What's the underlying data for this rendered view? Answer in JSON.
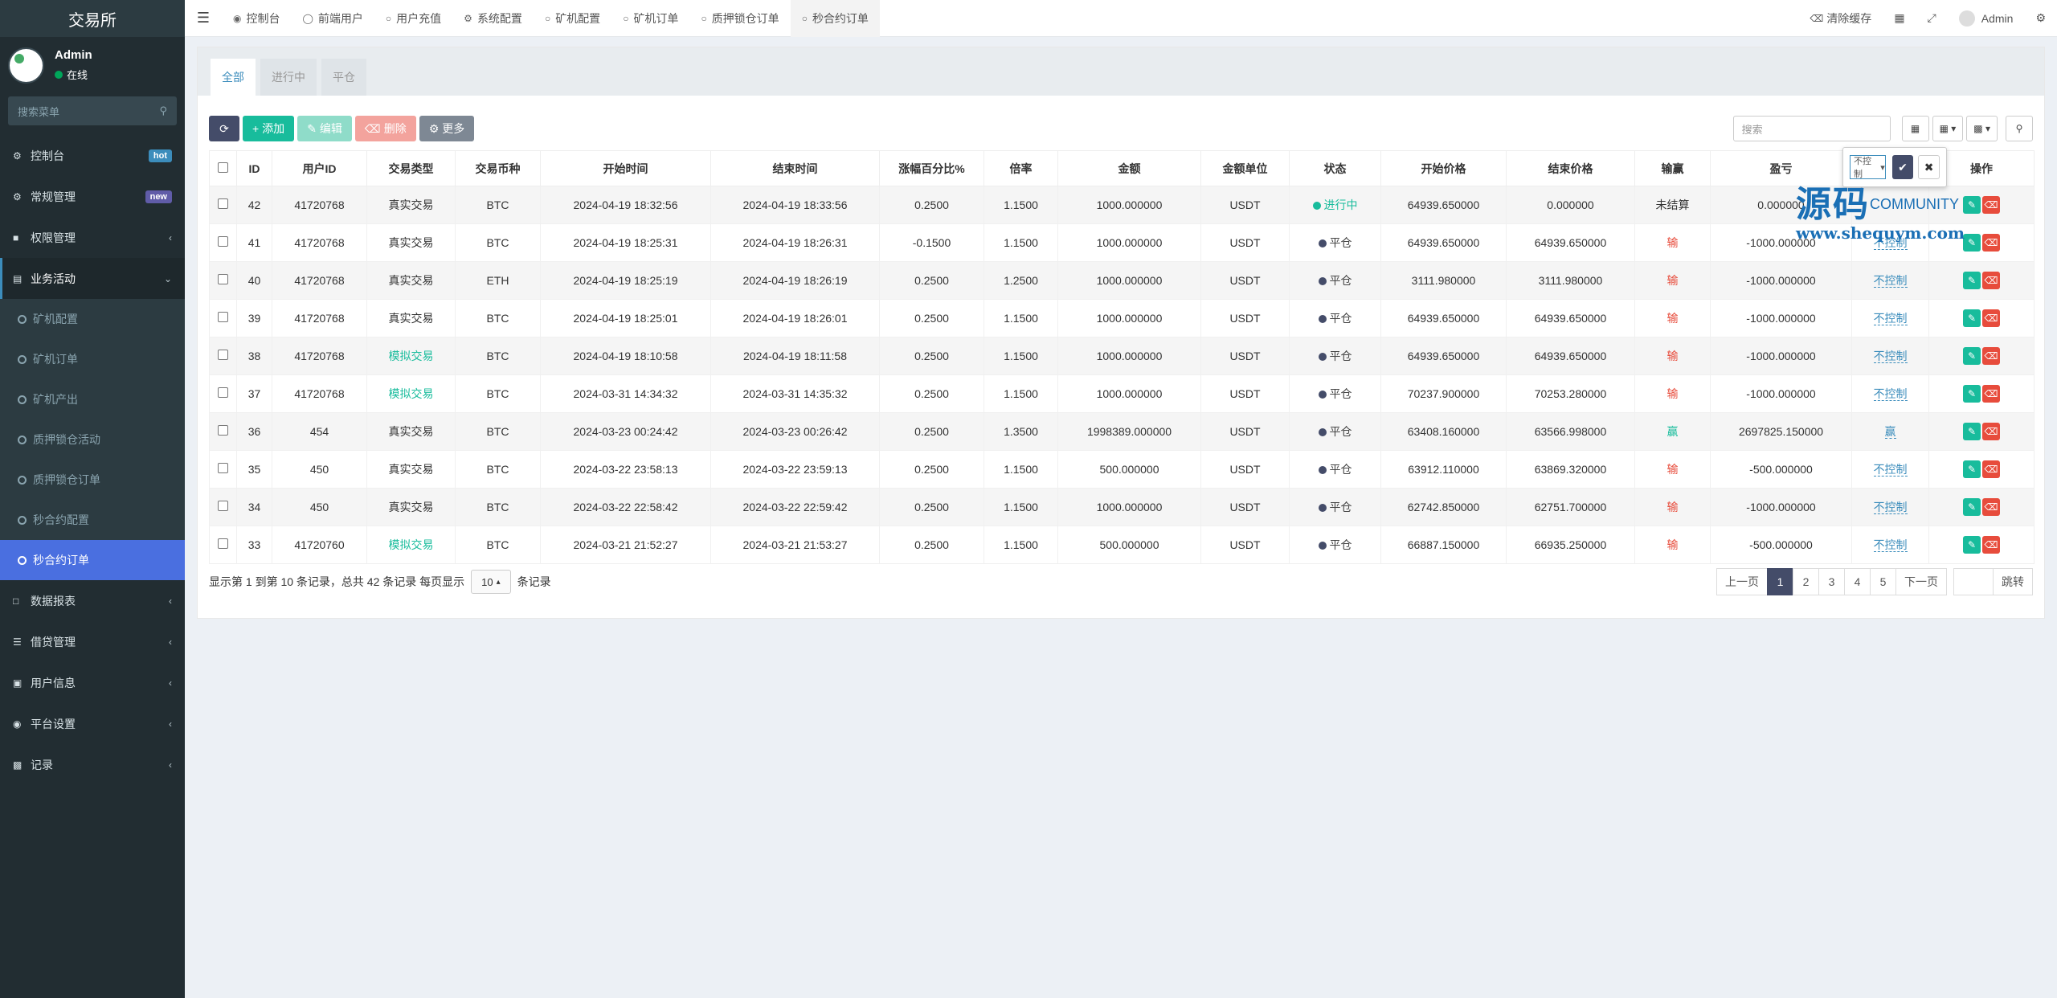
{
  "brand": "交易所",
  "user": {
    "name": "Admin",
    "status": "在线"
  },
  "sidebar": {
    "search_placeholder": "搜索菜单",
    "items": [
      {
        "label": "控制台",
        "icon": "dashboard-icon",
        "badge": "hot"
      },
      {
        "label": "常规管理",
        "icon": "cogs-icon",
        "badge": "new"
      },
      {
        "label": "权限管理",
        "icon": "group-icon"
      },
      {
        "label": "业务活动",
        "icon": "list-icon",
        "open": true
      }
    ],
    "sub_items": [
      "矿机配置",
      "矿机订单",
      "矿机产出",
      "质押锁仓活动",
      "质押锁仓订单",
      "秒合约配置",
      "秒合约订单"
    ],
    "items_after": [
      {
        "label": "数据报表",
        "icon": "file-icon"
      },
      {
        "label": "借贷管理",
        "icon": "list-icon"
      },
      {
        "label": "用户信息",
        "icon": "user-icon"
      },
      {
        "label": "平台设置",
        "icon": "settings-icon"
      },
      {
        "label": "记录",
        "icon": "chart-icon"
      }
    ]
  },
  "header": {
    "tabs": [
      "控制台",
      "前端用户",
      "用户充值",
      "系统配置",
      "矿机配置",
      "矿机订单",
      "质押锁仓订单",
      "秒合约订单"
    ],
    "clear_cache": "清除缓存",
    "admin": "Admin"
  },
  "content": {
    "tabs": [
      "全部",
      "进行中",
      "平仓"
    ],
    "toolbar": {
      "add": "添加",
      "edit": "编辑",
      "delete": "删除",
      "more": "更多",
      "search_placeholder": "搜索"
    },
    "columns": [
      "ID",
      "用户ID",
      "交易类型",
      "交易币种",
      "开始时间",
      "结束时间",
      "涨幅百分比%",
      "倍率",
      "金额",
      "金额单位",
      "状态",
      "开始价格",
      "结束价格",
      "输赢",
      "盈亏",
      "",
      "操作"
    ],
    "rows": [
      {
        "id": "42",
        "uid": "41720768",
        "type": "真实交易",
        "coin": "BTC",
        "start": "2024-04-19 18:32:56",
        "end": "2024-04-19 18:33:56",
        "pct": "0.2500",
        "rate": "1.1500",
        "amount": "1000.000000",
        "unit": "USDT",
        "status": "进行中",
        "sp": "64939.650000",
        "ep": "0.000000",
        "result": "未结算",
        "pnl": "0.000000",
        "ctl": ""
      },
      {
        "id": "41",
        "uid": "41720768",
        "type": "真实交易",
        "coin": "BTC",
        "start": "2024-04-19 18:25:31",
        "end": "2024-04-19 18:26:31",
        "pct": "-0.1500",
        "rate": "1.1500",
        "amount": "1000.000000",
        "unit": "USDT",
        "status": "平仓",
        "sp": "64939.650000",
        "ep": "64939.650000",
        "result": "输",
        "pnl": "-1000.000000",
        "ctl": "不控制"
      },
      {
        "id": "40",
        "uid": "41720768",
        "type": "真实交易",
        "coin": "ETH",
        "start": "2024-04-19 18:25:19",
        "end": "2024-04-19 18:26:19",
        "pct": "0.2500",
        "rate": "1.2500",
        "amount": "1000.000000",
        "unit": "USDT",
        "status": "平仓",
        "sp": "3111.980000",
        "ep": "3111.980000",
        "result": "输",
        "pnl": "-1000.000000",
        "ctl": "不控制"
      },
      {
        "id": "39",
        "uid": "41720768",
        "type": "真实交易",
        "coin": "BTC",
        "start": "2024-04-19 18:25:01",
        "end": "2024-04-19 18:26:01",
        "pct": "0.2500",
        "rate": "1.1500",
        "amount": "1000.000000",
        "unit": "USDT",
        "status": "平仓",
        "sp": "64939.650000",
        "ep": "64939.650000",
        "result": "输",
        "pnl": "-1000.000000",
        "ctl": "不控制"
      },
      {
        "id": "38",
        "uid": "41720768",
        "type": "模拟交易",
        "coin": "BTC",
        "start": "2024-04-19 18:10:58",
        "end": "2024-04-19 18:11:58",
        "pct": "0.2500",
        "rate": "1.1500",
        "amount": "1000.000000",
        "unit": "USDT",
        "status": "平仓",
        "sp": "64939.650000",
        "ep": "64939.650000",
        "result": "输",
        "pnl": "-1000.000000",
        "ctl": "不控制"
      },
      {
        "id": "37",
        "uid": "41720768",
        "type": "模拟交易",
        "coin": "BTC",
        "start": "2024-03-31 14:34:32",
        "end": "2024-03-31 14:35:32",
        "pct": "0.2500",
        "rate": "1.1500",
        "amount": "1000.000000",
        "unit": "USDT",
        "status": "平仓",
        "sp": "70237.900000",
        "ep": "70253.280000",
        "result": "输",
        "pnl": "-1000.000000",
        "ctl": "不控制"
      },
      {
        "id": "36",
        "uid": "454",
        "type": "真实交易",
        "coin": "BTC",
        "start": "2024-03-23 00:24:42",
        "end": "2024-03-23 00:26:42",
        "pct": "0.2500",
        "rate": "1.3500",
        "amount": "1998389.000000",
        "unit": "USDT",
        "status": "平仓",
        "sp": "63408.160000",
        "ep": "63566.998000",
        "result": "赢",
        "pnl": "2697825.150000",
        "ctl": "赢"
      },
      {
        "id": "35",
        "uid": "450",
        "type": "真实交易",
        "coin": "BTC",
        "start": "2024-03-22 23:58:13",
        "end": "2024-03-22 23:59:13",
        "pct": "0.2500",
        "rate": "1.1500",
        "amount": "500.000000",
        "unit": "USDT",
        "status": "平仓",
        "sp": "63912.110000",
        "ep": "63869.320000",
        "result": "输",
        "pnl": "-500.000000",
        "ctl": "不控制"
      },
      {
        "id": "34",
        "uid": "450",
        "type": "真实交易",
        "coin": "BTC",
        "start": "2024-03-22 22:58:42",
        "end": "2024-03-22 22:59:42",
        "pct": "0.2500",
        "rate": "1.1500",
        "amount": "1000.000000",
        "unit": "USDT",
        "status": "平仓",
        "sp": "62742.850000",
        "ep": "62751.700000",
        "result": "输",
        "pnl": "-1000.000000",
        "ctl": "不控制"
      },
      {
        "id": "33",
        "uid": "41720760",
        "type": "模拟交易",
        "coin": "BTC",
        "start": "2024-03-21 21:52:27",
        "end": "2024-03-21 21:53:27",
        "pct": "0.2500",
        "rate": "1.1500",
        "amount": "500.000000",
        "unit": "USDT",
        "status": "平仓",
        "sp": "66887.150000",
        "ep": "66935.250000",
        "result": "输",
        "pnl": "-500.000000",
        "ctl": "不控制"
      }
    ],
    "footer": {
      "summary": "显示第 1 到第 10 条记录，总共 42 条记录 每页显示",
      "page_size": "10",
      "suffix": "条记录"
    },
    "pager": {
      "prev": "上一页",
      "pages": [
        "1",
        "2",
        "3",
        "4",
        "5"
      ],
      "next": "下一页",
      "go": "跳转"
    },
    "popover": {
      "select_value": "不控制"
    },
    "watermark": {
      "big": "源码",
      "community": "COMMUNITY",
      "url": "www.shequym.com"
    }
  }
}
